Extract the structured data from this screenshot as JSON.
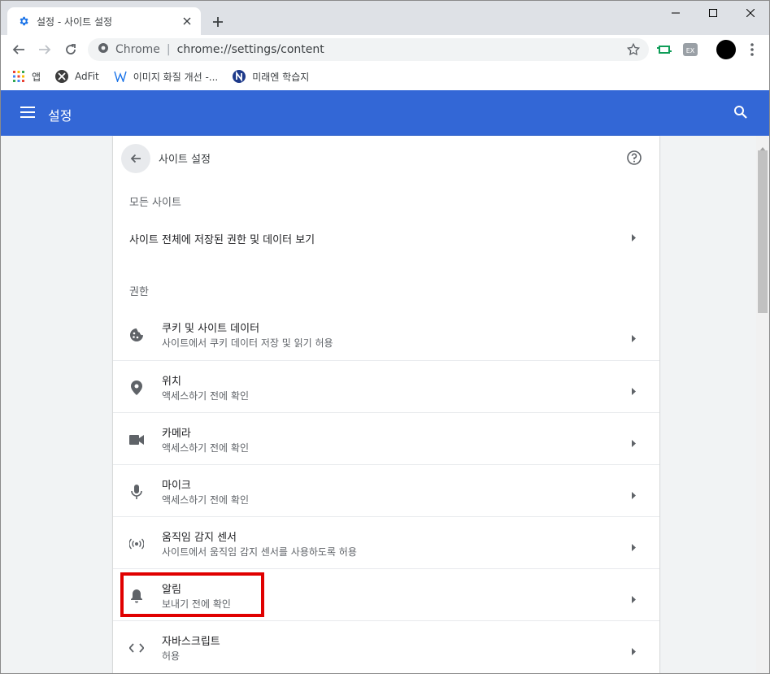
{
  "tab": {
    "title": "설정 - 사이트 설정"
  },
  "omnibox": {
    "label": "Chrome",
    "separator": "|",
    "url": "chrome://settings/content"
  },
  "bookmarks": [
    {
      "label": "앱",
      "icon": "apps-grid-icon"
    },
    {
      "label": "AdFit",
      "icon": "adfit-icon"
    },
    {
      "label": "이미지 화질 개선 -...",
      "icon": "w-logo-icon"
    },
    {
      "label": "미래엔 학습지",
      "icon": "n-logo-icon"
    }
  ],
  "header": {
    "title": "설정"
  },
  "page": {
    "title": "사이트 설정",
    "all_sites_label": "모든 사이트",
    "all_sites_link": "사이트 전체에 저장된 권한 및 데이터 보기",
    "permissions_label": "권한"
  },
  "permissions": [
    {
      "title": "쿠키 및 사이트 데이터",
      "subtitle": "사이트에서 쿠키 데이터 저장 및 읽기 허용",
      "icon": "cookie-icon"
    },
    {
      "title": "위치",
      "subtitle": "액세스하기 전에 확인",
      "icon": "location-pin-icon"
    },
    {
      "title": "카메라",
      "subtitle": "액세스하기 전에 확인",
      "icon": "camera-icon"
    },
    {
      "title": "마이크",
      "subtitle": "액세스하기 전에 확인",
      "icon": "microphone-icon"
    },
    {
      "title": "움직임 감지 센서",
      "subtitle": "사이트에서 움직임 감지 센서를 사용하도록 허용",
      "icon": "sensors-icon"
    },
    {
      "title": "알림",
      "subtitle": "보내기 전에 확인",
      "icon": "bell-icon"
    },
    {
      "title": "자바스크립트",
      "subtitle": "허용",
      "icon": "code-icon"
    }
  ],
  "colors": {
    "header": "#3367d6",
    "highlight": "#e00000",
    "background": "#f1f3f4"
  }
}
